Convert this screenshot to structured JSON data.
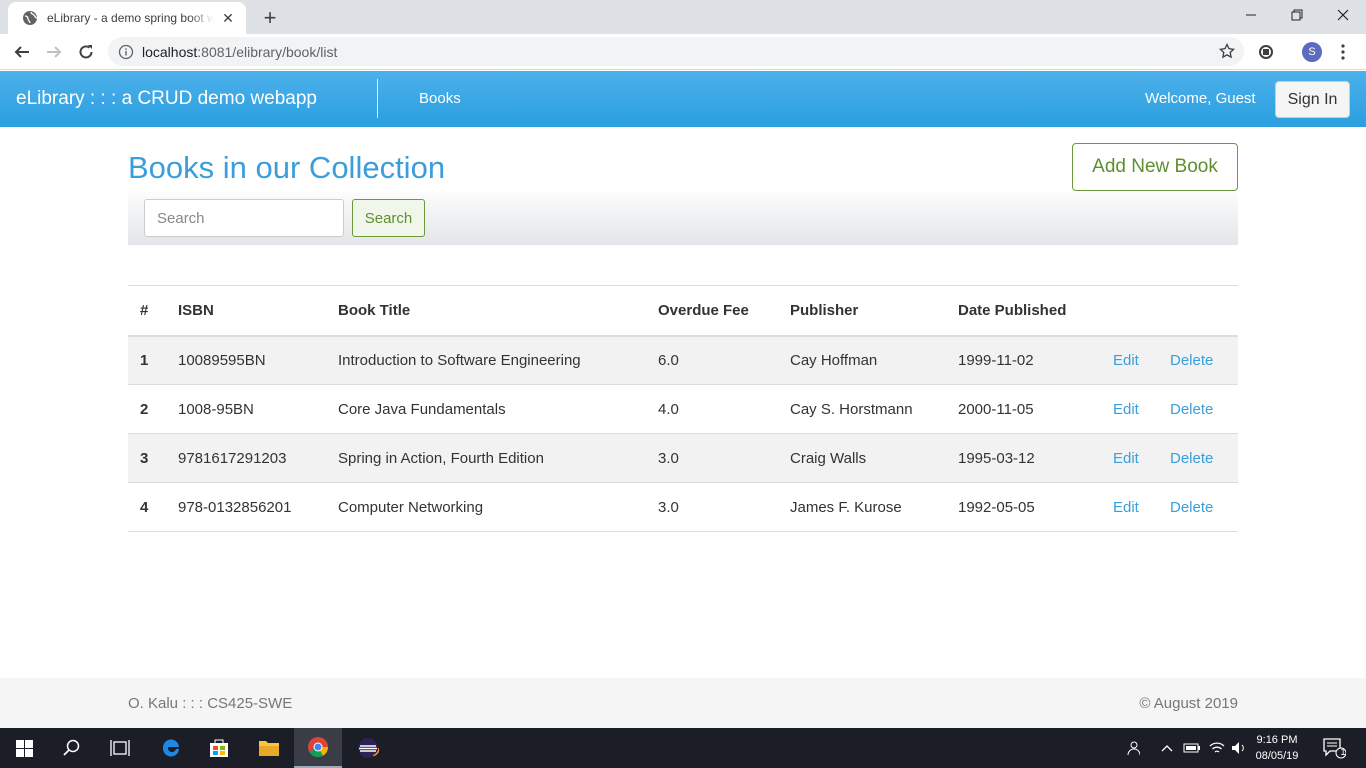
{
  "browser": {
    "tab_title": "eLibrary - a demo spring boot webapp",
    "url_host": "localhost",
    "url_path": ":8081/elibrary/book/list",
    "profile_initial": "S"
  },
  "navbar": {
    "brand": "eLibrary : : : a CRUD demo webapp",
    "books_link": "Books",
    "welcome": "Welcome, Guest",
    "signin_label": "Sign In"
  },
  "main": {
    "title": "Books in our Collection",
    "add_button": "Add New Book",
    "search_placeholder": "Search",
    "search_button": "Search"
  },
  "table": {
    "headers": [
      "#",
      "ISBN",
      "Book Title",
      "Overdue Fee",
      "Publisher",
      "Date Published"
    ],
    "rows": [
      {
        "num": "1",
        "isbn": "10089595BN",
        "title": "Introduction to Software Engineering",
        "fee": "6.0",
        "publisher": "Cay Hoffman",
        "date": "1999-11-02",
        "edit": "Edit",
        "delete": "Delete"
      },
      {
        "num": "2",
        "isbn": "1008-95BN",
        "title": "Core Java Fundamentals",
        "fee": "4.0",
        "publisher": "Cay S. Horstmann",
        "date": "2000-11-05",
        "edit": "Edit",
        "delete": "Delete"
      },
      {
        "num": "3",
        "isbn": "9781617291203",
        "title": "Spring in Action, Fourth Edition",
        "fee": "3.0",
        "publisher": "Craig Walls",
        "date": "1995-03-12",
        "edit": "Edit",
        "delete": "Delete"
      },
      {
        "num": "4",
        "isbn": "978-0132856201",
        "title": "Computer Networking",
        "fee": "3.0",
        "publisher": "James F. Kurose",
        "date": "1992-05-05",
        "edit": "Edit",
        "delete": "Delete"
      }
    ]
  },
  "footer": {
    "left": "O. Kalu : : : CS425-SWE",
    "right": "© August 2019"
  },
  "taskbar": {
    "time": "9:16 PM",
    "date": "08/05/19",
    "notification_count": "1"
  },
  "colors": {
    "navbar": "#2a9fe0",
    "accent_blue": "#3a9edc",
    "accent_green": "#5d8f30"
  }
}
